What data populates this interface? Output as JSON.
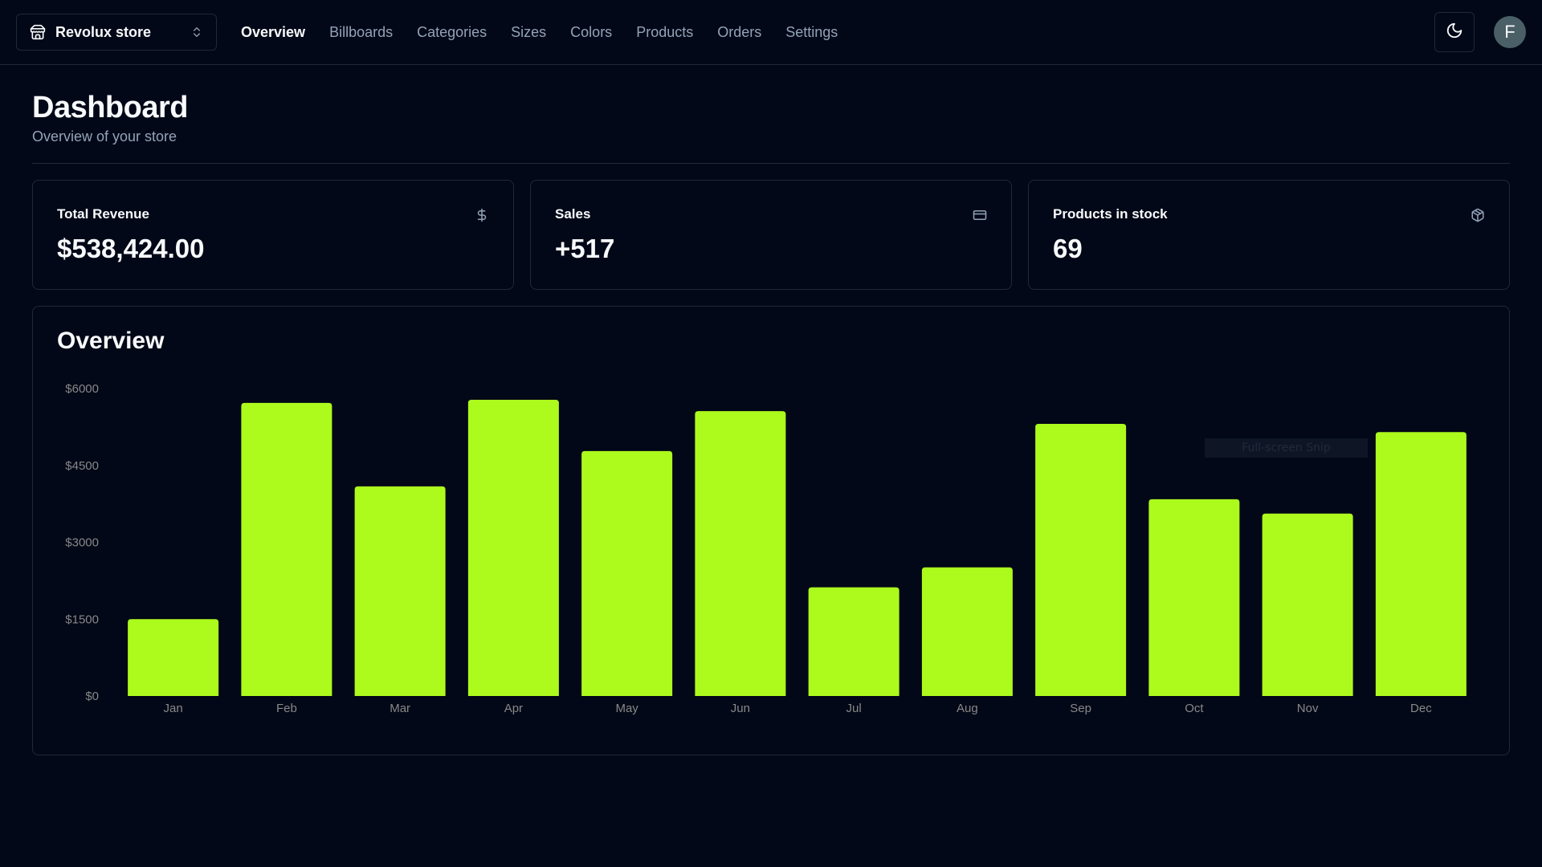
{
  "navbar": {
    "store_name": "Revolux store",
    "store_icon": "store-icon",
    "switcher_icon": "chevrons-up-down-icon",
    "links": [
      {
        "label": "Overview",
        "active": true
      },
      {
        "label": "Billboards",
        "active": false
      },
      {
        "label": "Categories",
        "active": false
      },
      {
        "label": "Sizes",
        "active": false
      },
      {
        "label": "Colors",
        "active": false
      },
      {
        "label": "Products",
        "active": false
      },
      {
        "label": "Orders",
        "active": false
      },
      {
        "label": "Settings",
        "active": false
      }
    ],
    "theme_icon": "moon-icon",
    "avatar_initial": "F"
  },
  "header": {
    "title": "Dashboard",
    "subtitle": "Overview of your store"
  },
  "cards": [
    {
      "title": "Total Revenue",
      "value": "$538,424.00",
      "icon": "dollar-sign-icon"
    },
    {
      "title": "Sales",
      "value": "+517",
      "icon": "credit-card-icon"
    },
    {
      "title": "Products in stock",
      "value": "69",
      "icon": "package-icon"
    }
  ],
  "overlay": {
    "snip_label": "Full-screen Snip"
  },
  "colors": {
    "background": "#020817",
    "border": "#1e293b",
    "bar": "#adfa1d",
    "muted_text": "#94a3b8",
    "axis_text": "#888888"
  },
  "chart_data": {
    "type": "bar",
    "title": "Overview",
    "categories": [
      "Jan",
      "Feb",
      "Mar",
      "Apr",
      "May",
      "Jun",
      "Jul",
      "Aug",
      "Sep",
      "Oct",
      "Nov",
      "Dec"
    ],
    "values": [
      1500,
      5720,
      4090,
      5780,
      4780,
      5560,
      2120,
      2510,
      5310,
      3840,
      3560,
      5150
    ],
    "xlabel": "",
    "ylabel": "",
    "ylim": [
      0,
      6000
    ],
    "yticks": [
      0,
      1500,
      3000,
      4500,
      6000
    ],
    "ytick_labels": [
      "$0",
      "$1500",
      "$3000",
      "$4500",
      "$6000"
    ],
    "grid": false,
    "legend": "none"
  }
}
